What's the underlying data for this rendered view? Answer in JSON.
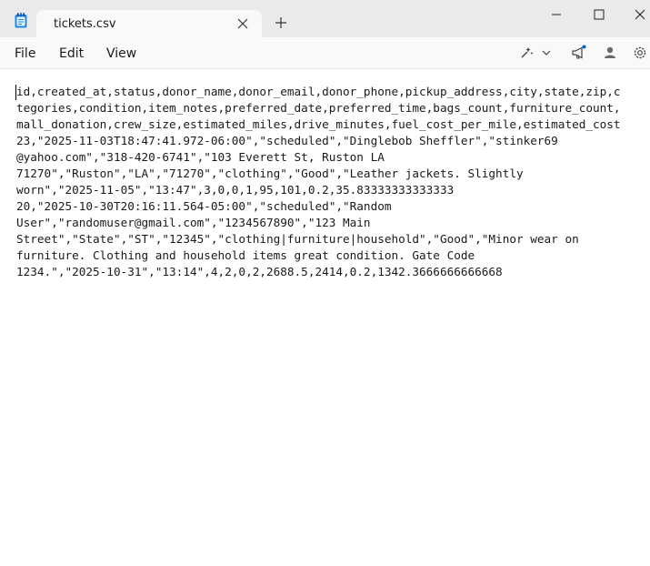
{
  "window": {
    "tab_title": "tickets.csv",
    "app_icon": "notepad-icon"
  },
  "menu": {
    "file": "File",
    "edit": "Edit",
    "view": "View"
  },
  "toolbar_icons": [
    "copilot-icon",
    "chevron-down-icon",
    "megaphone-icon",
    "account-icon",
    "gear-icon"
  ],
  "accent_color": "#0067c0",
  "document": {
    "lines": [
      "id,created_at,status,donor_name,donor_email,donor_phone,pickup_address,city,state,zip,c",
      "tegories,condition,item_notes,preferred_date,preferred_time,bags_count,furniture_count,",
      "mall_donation,crew_size,estimated_miles,drive_minutes,fuel_cost_per_mile,estimated_cost",
      "23,\"2025-11-03T18:47:41.972-06:00\",\"scheduled\",\"Dinglebob Sheffler\",\"stinker69",
      "@yahoo.com\",\"318-420-6741\",\"103 Everett St, Ruston LA",
      "71270\",\"Ruston\",\"LA\",\"71270\",\"clothing\",\"Good\",\"Leather jackets. Slightly",
      "worn\",\"2025-11-05\",\"13:47\",3,0,0,1,95,101,0.2,35.83333333333333",
      "20,\"2025-10-30T20:16:11.564-05:00\",\"scheduled\",\"Random",
      "User\",\"randomuser@gmail.com\",\"1234567890\",\"123 Main",
      "Street\",\"State\",\"ST\",\"12345\",\"clothing|furniture|household\",\"Good\",\"Minor wear on",
      "furniture. Clothing and household items great condition. Gate Code",
      "1234.\",\"2025-10-31\",\"13:14\",4,2,0,2,2688.5,2414,0.2,1342.3666666666668"
    ]
  }
}
